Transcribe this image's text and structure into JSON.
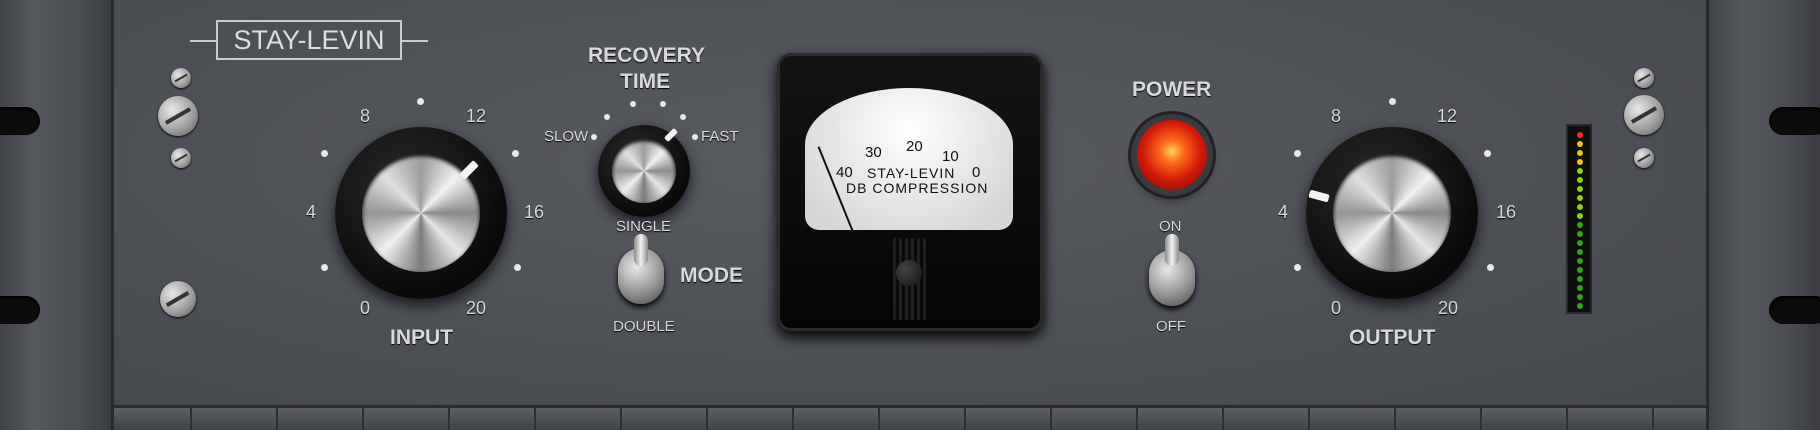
{
  "brand": "STAY-LEVIN",
  "input": {
    "label": "INPUT",
    "scale": [
      "0",
      "4",
      "8",
      "12",
      "16",
      "20"
    ]
  },
  "output": {
    "label": "OUTPUT",
    "scale": [
      "0",
      "4",
      "8",
      "12",
      "16",
      "20"
    ]
  },
  "recovery": {
    "title_line1": "RECOVERY",
    "title_line2": "TIME",
    "slow": "SLOW",
    "fast": "FAST"
  },
  "mode": {
    "label": "MODE",
    "top": "SINGLE",
    "bottom": "DOUBLE"
  },
  "meter": {
    "brand": "STAY-LEVIN",
    "subtitle": "DB COMPRESSION",
    "scale": [
      "40",
      "30",
      "20",
      "10",
      "0"
    ]
  },
  "power": {
    "label": "POWER",
    "on": "ON",
    "off": "OFF",
    "lamp_color": "#ff3a10"
  },
  "led_meter": {
    "colors": {
      "top": "#ff2a1a",
      "upper": "#f0c020",
      "mid": "#8ad020",
      "low": "#3aa020"
    }
  }
}
